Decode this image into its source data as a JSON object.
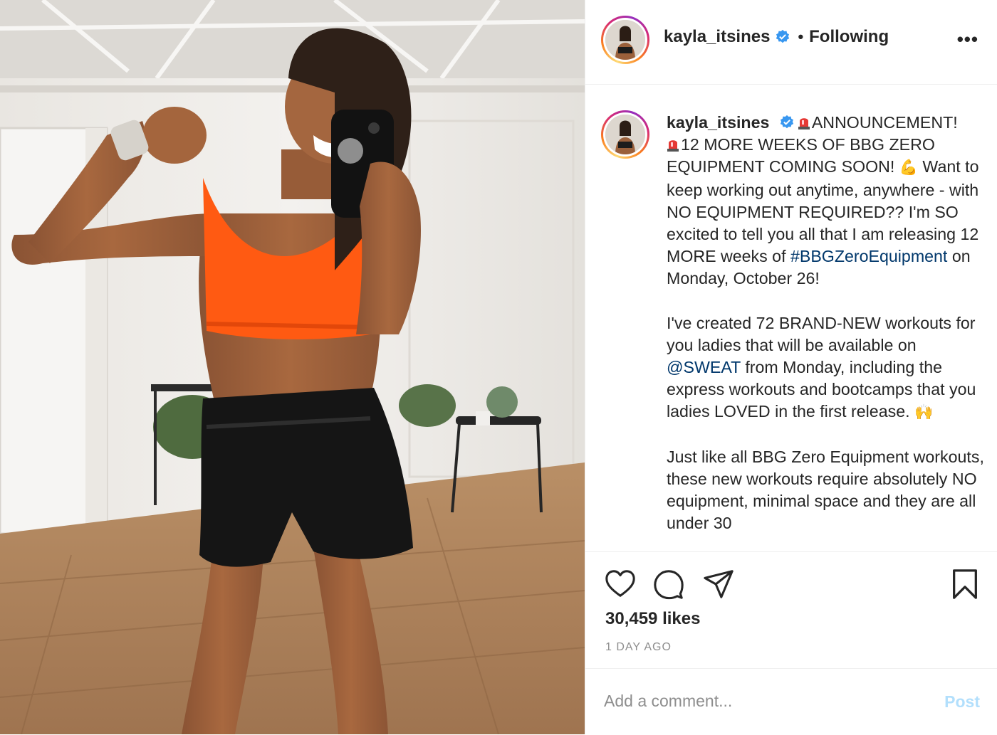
{
  "post": {
    "username": "kayla_itsines",
    "follow_status": "Following",
    "more_label": "•••"
  },
  "caption": {
    "username": "kayla_itsines",
    "lines": [
      "ANNOUNCEMENT!",
      "12 MORE WEEKS OF BBG ZERO EQUIPMENT COMING SOON!",
      "Want to keep working out anytime, anywhere - with NO EQUIPMENT REQUIRED?? I'm SO excited to tell you all that I am releasing 12 MORE weeks of",
      "#BBGZeroEquipment",
      "on Monday, October 26!",
      "I've created 72 BRAND-NEW workouts for you ladies that will be available on",
      "@SWEAT",
      "from Monday, including the express workouts and bootcamps that you ladies LOVED in the first release.",
      "Just like all BBG Zero Equipment workouts, these new workouts require absolutely NO equipment, minimal space and they are all under 30"
    ],
    "emoji": {
      "muscle": "💪",
      "raised_hands": "🙌"
    }
  },
  "actions": {
    "like_icon": "heart-icon",
    "comment_icon": "comment-icon",
    "share_icon": "share-icon",
    "save_icon": "bookmark-icon"
  },
  "likes": "30,459 likes",
  "time_ago": "1 DAY AGO",
  "comment": {
    "placeholder": "Add a comment...",
    "post_label": "Post"
  },
  "colors": {
    "link": "#00376b",
    "verified": "#3897f0",
    "post_disabled": "#b2dffc",
    "muted": "#8e8e8e"
  }
}
